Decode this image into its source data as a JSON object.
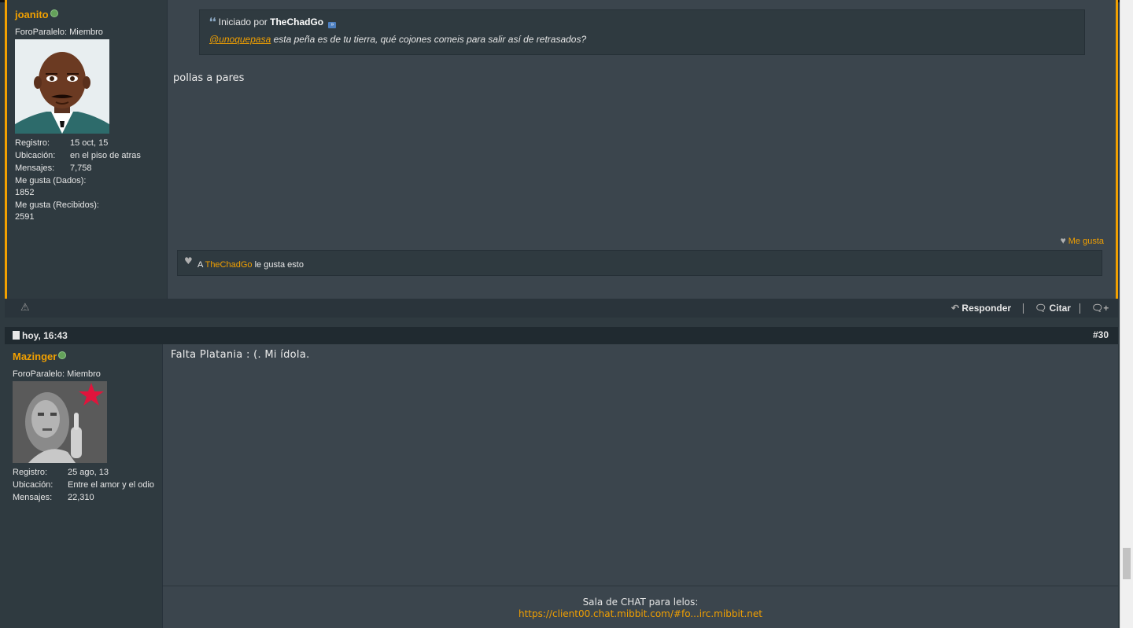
{
  "post1": {
    "username": "joanito",
    "user_title": "ForoParalelo: Miembro",
    "stats": [
      {
        "label": "Registro:",
        "value": "15 oct, 15"
      },
      {
        "label": "Ubicación:",
        "value": "en el piso de atras"
      },
      {
        "label": "Mensajes:",
        "value": "7,758"
      }
    ],
    "likes_given_label": "Me gusta (Dados):",
    "likes_given_value": "1852",
    "likes_received_label": "Me gusta (Recibidos):",
    "likes_received_value": "2591",
    "quote": {
      "started_by": "Iniciado por",
      "author": "TheChadGo",
      "mention": "unoquepasa",
      "text": " esta peña es de tu tierra, qué cojones comeis para salir así de retrasados?"
    },
    "message": "pollas a pares",
    "like_button": "Me gusta",
    "likes_summary": {
      "prefix": "A",
      "user": "TheChadGo",
      "suffix": "le gusta esto"
    }
  },
  "actions": {
    "reply": "Responder",
    "quote": "Citar"
  },
  "post2": {
    "date": "hoy, 16:43",
    "number": "#30",
    "username": "Mazinger",
    "user_title": "ForoParalelo: Miembro",
    "stats": [
      {
        "label": "Registro:",
        "value": "25 ago, 13"
      },
      {
        "label": "Ubicación:",
        "value": "Entre el amor y el odio"
      },
      {
        "label": "Mensajes:",
        "value": "22,310"
      }
    ],
    "message": "Falta Platania : (. Mi ídola.",
    "signature_title": "Sala de CHAT para lelos:",
    "signature_link": "https://client00.chat.mibbit.com/#fo...irc.mibbit.net"
  },
  "colors": {
    "accent": "#f2a000",
    "post_bg": "#3b454d",
    "sidebar_bg": "#2f3a40",
    "online": "#64a15a"
  }
}
